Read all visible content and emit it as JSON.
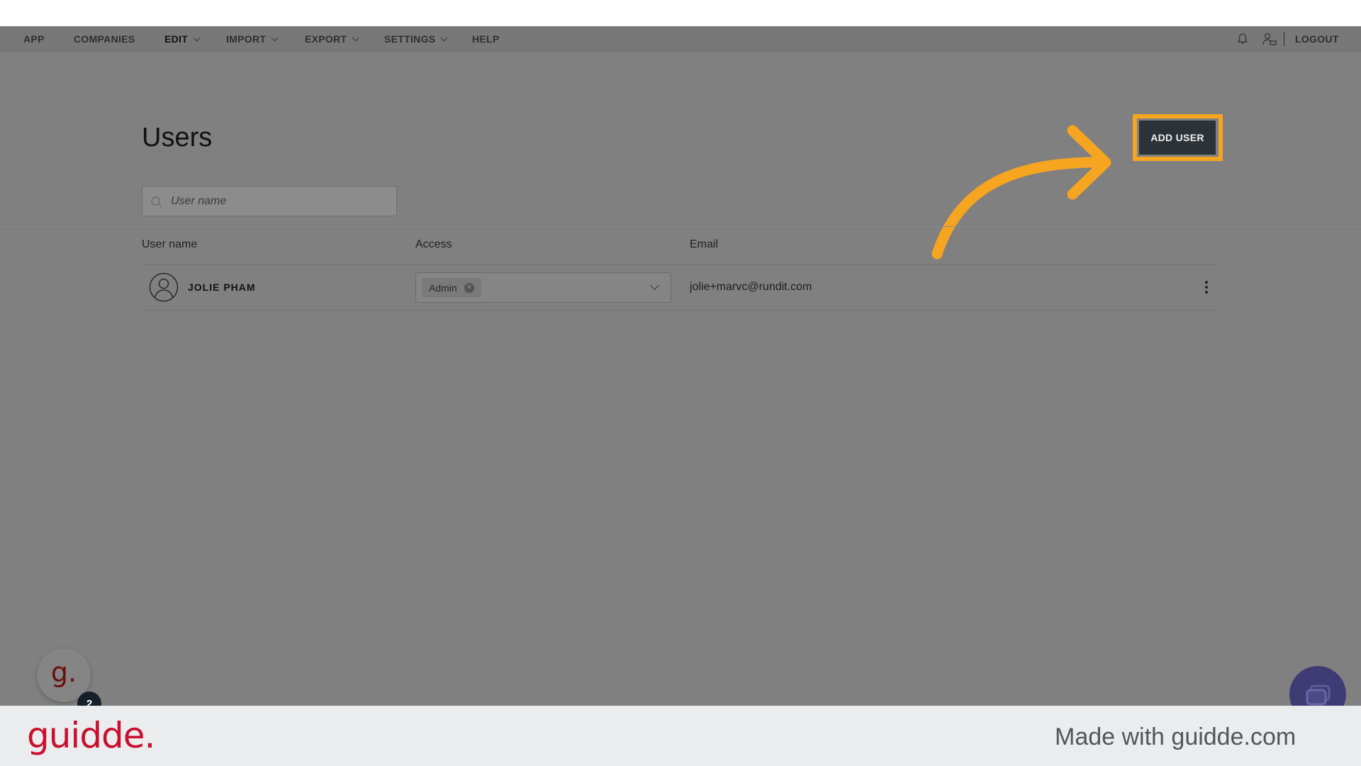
{
  "navbar": {
    "items": [
      {
        "label": "APP"
      },
      {
        "label": "COMPANIES"
      },
      {
        "label": "EDIT"
      },
      {
        "label": "IMPORT"
      },
      {
        "label": "EXPORT"
      },
      {
        "label": "SETTINGS"
      },
      {
        "label": "HELP"
      }
    ],
    "logout_label": "LOGOUT"
  },
  "main": {
    "title": "Users",
    "add_user_label": "ADD USER",
    "search": {
      "placeholder": "User name",
      "value": ""
    }
  },
  "table": {
    "columns": [
      "User name",
      "Access",
      "Email"
    ],
    "rows": [
      {
        "name": "JOLIE PHAM",
        "access": "Admin",
        "email": "jolie+marvc@rundit.com"
      }
    ]
  },
  "widgets": {
    "guidde_bubble_letter": "g.",
    "guidde_badge_count": "2"
  },
  "footer": {
    "logo_text": "guidde.",
    "made_with": "Made with guidde.com"
  },
  "colors": {
    "highlight": "#f5a51f",
    "brand_red": "#c8102e",
    "button_dark": "#2c3338",
    "chat_purple": "#3f3c75"
  }
}
